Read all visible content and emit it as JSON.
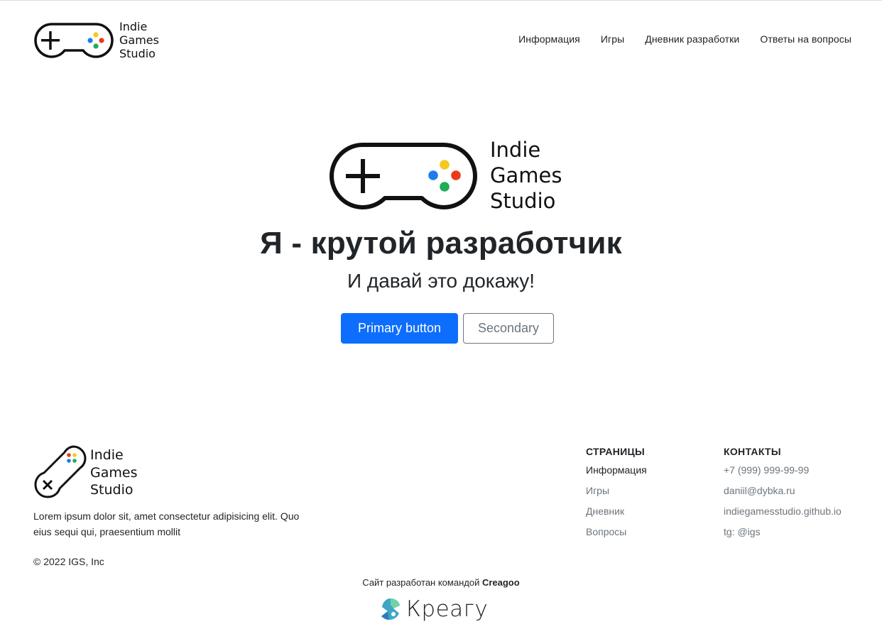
{
  "brand": {
    "line1": "Indie",
    "line2": "Games",
    "line3": "Studio"
  },
  "nav": {
    "items": [
      "Информация",
      "Игры",
      "Дневник разработки",
      "Ответы на вопросы"
    ]
  },
  "hero": {
    "title": "Я - крутой разработчик",
    "subtitle": "И давай это докажу!",
    "primary_button": "Primary button",
    "secondary_button": "Secondary"
  },
  "footer": {
    "description": "Lorem ipsum dolor sit, amet consectetur adipisicing elit. Quo eius sequi qui, praesentium mollit",
    "copyright": "© 2022 IGS, Inc",
    "pages": {
      "heading": "СТРАНИЦЫ",
      "links": [
        "Информация",
        "Игры",
        "Дневник",
        "Вопросы"
      ]
    },
    "contacts": {
      "heading": "КОНТАКТЫ",
      "links": [
        "+7 (999) 999-99-99",
        "daniil@dybka.ru",
        "indiegamesstudio.github.io",
        "tg: @igs"
      ]
    },
    "credit_prefix": "Сайт разработан командой ",
    "credit_team": "Creagoo",
    "partner_wordmark": "Креагу"
  },
  "colors": {
    "primary": "#0d6efd",
    "secondary": "#6c757d",
    "button_yellow": "#f4c81e",
    "button_red": "#ea3a1a",
    "button_blue": "#1f7bea",
    "button_green": "#1fad55"
  },
  "icons": {
    "brand_logo": "gamepad-icon",
    "footer_logo": "gamepad-vertical-icon",
    "partner_logo": "creagoo-logo-icon"
  }
}
